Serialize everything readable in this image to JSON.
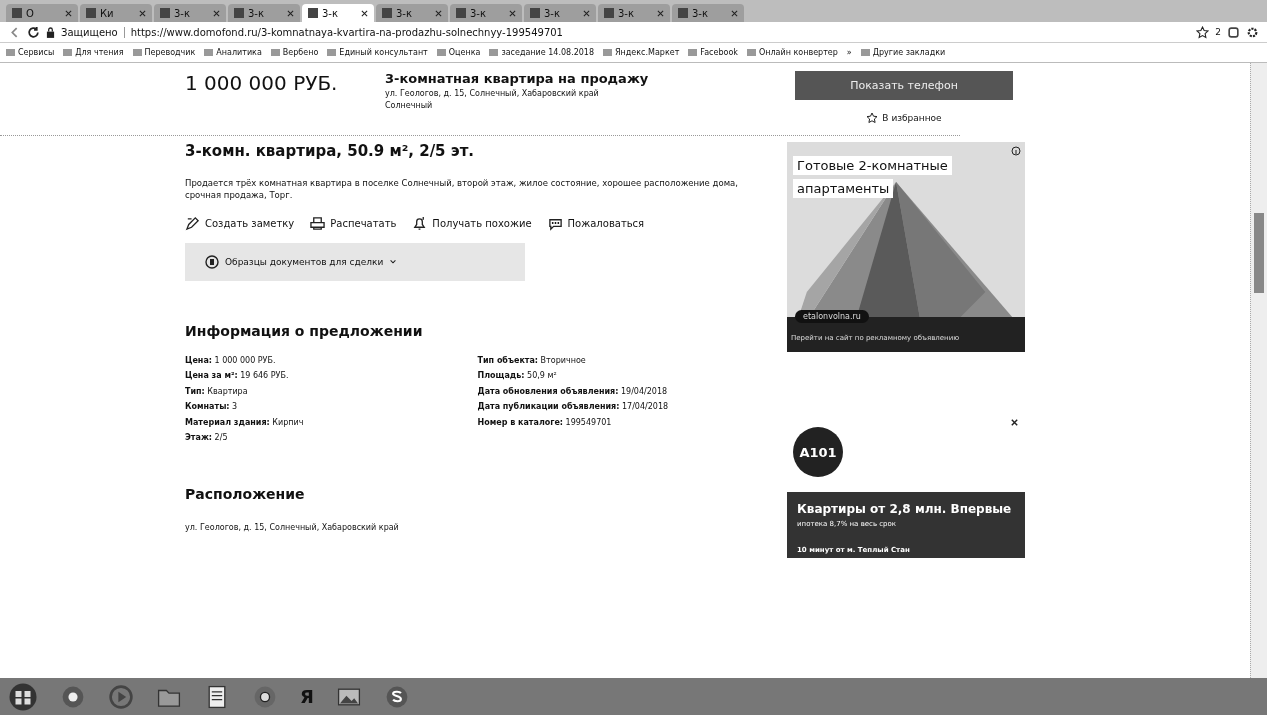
{
  "browser": {
    "tabs": [
      {
        "label": "О",
        "selected": false
      },
      {
        "label": "Ки",
        "selected": false
      },
      {
        "label": "3-к",
        "selected": false
      },
      {
        "label": "3-к",
        "selected": false
      },
      {
        "label": "3-к",
        "selected": true
      },
      {
        "label": "3-к",
        "selected": false
      },
      {
        "label": "3-к",
        "selected": false
      },
      {
        "label": "3-к",
        "selected": false
      },
      {
        "label": "3-к",
        "selected": false
      },
      {
        "label": "3-к",
        "selected": false
      }
    ],
    "secure_label": "Защищено",
    "url": "https://www.domofond.ru/3-komnatnaya-kvartira-na-prodazhu-solnechnyy-199549701",
    "extension_badge": "2",
    "bookmarks": [
      "Сервисы",
      "Для чтения",
      "Переводчик",
      "Аналитика",
      "Вербено",
      "Единый консультант",
      "Оценка",
      "заседание 14.08.2018",
      "Яндекс.Маркет",
      "Facebook",
      "Онлайн конвертер"
    ],
    "bookmarks_more": "»",
    "other_bookmarks": "Другие закладки"
  },
  "listing": {
    "price": "1 000 000 РУБ.",
    "title": "3-комнатная квартира на продажу",
    "address": "ул. Геологов, д. 15, Солнечный, Хабаровский край",
    "locality": "Солнечный",
    "contact_button": "Показать телефон",
    "favorite": "В избранное",
    "heading": "3-комн. квартира, 50.9 м², 2/5 эт.",
    "description": "Продается трёх комнатная квартира в поселке Солнечный, второй этаж, жилое состояние, хорошее расположение дома, срочная продажа, Торг.",
    "actions": [
      {
        "kind": "note",
        "label": "Создать заметку"
      },
      {
        "kind": "print",
        "label": "Распечатать"
      },
      {
        "kind": "subscribe",
        "label": "Получать похожие"
      },
      {
        "kind": "report",
        "label": "Пожаловаться"
      }
    ],
    "documents_link": "Образцы документов для сделки",
    "info_title": "Информация о предложении",
    "info_left": [
      "**Цена:** 1 000 000 РУБ.",
      "**Цена за м²:** 19 646 РУБ.",
      "**Тип:** Квартира",
      "**Комнаты:** 3",
      "**Материал здания:** Кирпич",
      "**Этаж:** 2/5"
    ],
    "info_right": [
      "**Тип объекта:** Вторичное",
      "**Площадь:** 50,9 м²",
      "**Дата обновления объявления:** 19/04/2018",
      "**Дата публикации объявления:** 17/04/2018",
      "**Номер в каталоге:** 199549701"
    ],
    "location_title": "Расположение",
    "location_address": "ул. Геологов, д. 15, Солнечный, Хабаровский край"
  },
  "ads": [
    {
      "headline_lines": [
        "Готовые 2-комнатные",
        "апартаменты"
      ],
      "site": "etalonvolna.ru",
      "footer": "Перейти на сайт по рекламному объявлению"
    },
    {
      "kind": "logo",
      "logo": "A101",
      "headline": "Квартиры от 2,8 млн. Впервые",
      "subline": "ипотека 8,7% на весь срок",
      "footer": "10 минут от м. Теплый Стан"
    }
  ],
  "taskbar": {
    "yandex": "Я"
  }
}
